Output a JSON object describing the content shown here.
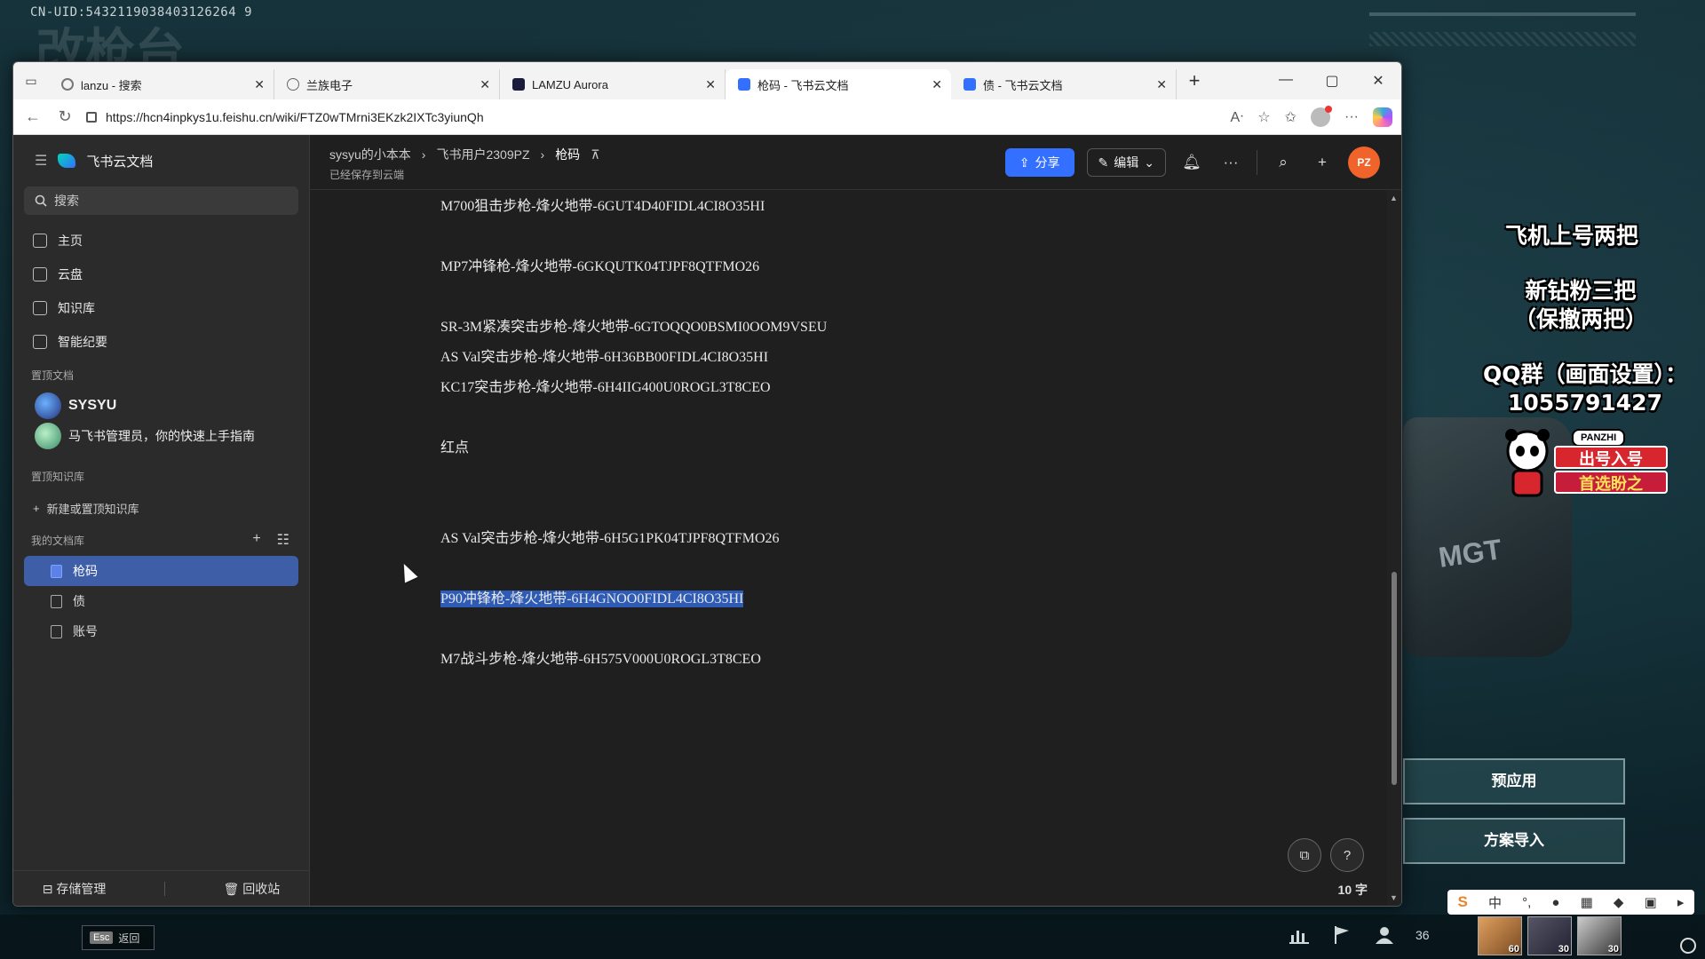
{
  "game": {
    "uid": "CN-UID:5432119038403126264 9",
    "bg_title": "改枪台",
    "overlay_lines": [
      "飞机上号两把",
      "新钻粉三把\n（保撤两把）",
      "QQ群（画面设置）：\n1055791427"
    ],
    "sticker": {
      "badge": "PANZHI",
      "line1": "出号入号",
      "line2": "首选盼之"
    },
    "gun_text": "MGT",
    "buttons": [
      "预应用",
      "方案导入"
    ],
    "esc_key": "Esc",
    "esc_label": "返回",
    "friends_count": "36",
    "avatar_levels": [
      "60",
      "30"
    ],
    "ime_chinese": "中"
  },
  "browser": {
    "tabs": [
      {
        "title": "lanzu - 搜索",
        "icon": "search-icon"
      },
      {
        "title": "兰族电子",
        "icon": "globe-icon"
      },
      {
        "title": "LAMZU Aurora",
        "icon": "lamzu-icon"
      },
      {
        "title": "枪码 - 飞书云文档",
        "icon": "doc-icon",
        "active": true
      },
      {
        "title": "债 - 飞书云文档",
        "icon": "doc-icon"
      }
    ],
    "url": "https://hcn4inpkys1u.feishu.cn/wiki/FTZ0wTMrni3EKzk2IXTc3yiunQh"
  },
  "sidebar": {
    "app_name": "飞书云文档",
    "search_placeholder": "搜索",
    "nav": [
      "主页",
      "云盘",
      "知识库",
      "智能纪要"
    ],
    "pinned_docs_title": "置顶文档",
    "pinned_docs": [
      {
        "label": "SYSYU"
      },
      {
        "label": "马飞书管理员，你的快速上手指南"
      }
    ],
    "pinned_kb_title": "置顶知识库",
    "new_kb": "新建或置顶知识库",
    "my_docs_title": "我的文档库",
    "my_docs": [
      {
        "label": "枪码",
        "active": true
      },
      {
        "label": "债"
      },
      {
        "label": "账号"
      }
    ],
    "footer": {
      "storage": "存储管理",
      "trash": "回收站"
    }
  },
  "header": {
    "breadcrumb": [
      "sysyu的小本本",
      "飞书用户2309PZ",
      "枪码"
    ],
    "saved": "已经保存到云端",
    "share": "分享",
    "edit": "编辑",
    "avatar": "PZ"
  },
  "doc": {
    "lines": [
      "M700狙击步枪-烽火地带-6GUT4D40FIDL4CI8O35HI",
      "MP7冲锋枪-烽火地带-6GKQUTK04TJPF8QTFMO26",
      "SR-3M紧凑突击步枪-烽火地带-6GTOQQO0BSMI0OOM9VSEU",
      "AS Val突击步枪-烽火地带-6H36BB00FIDL4CI8O35HI",
      "KC17突击步枪-烽火地带-6H4IIG400U0ROGL3T8CEO",
      "红点",
      "AS Val突击步枪-烽火地带-6H5G1PK04TJPF8QTFMO26",
      "P90冲锋枪-烽火地带-6H4GNOO0FIDL4CI8O35HI",
      "M7战斗步枪-烽火地带-6H575V000U0ROGL3T8CEO"
    ],
    "word_count": "10 字"
  },
  "colors": {
    "accent": "#3370ff",
    "selection": "#2e5bb6",
    "avatar": "#f0642c"
  }
}
